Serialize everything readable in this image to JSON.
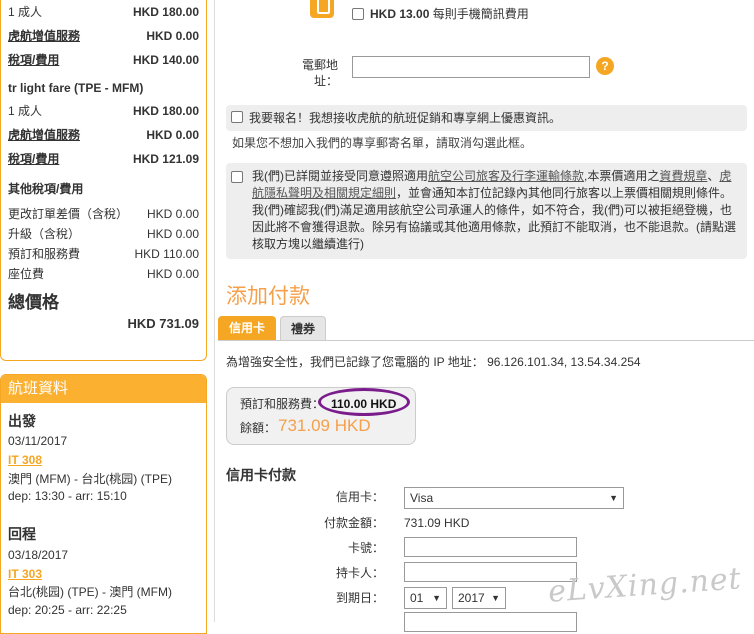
{
  "summary": {
    "r1_label": "1 成人",
    "r1_value": "HKD  180.00",
    "r2_label": "虎航增值服務",
    "r2_value": "HKD  0.00",
    "r3_label": "稅項/費用",
    "r3_value": "HKD  140.00",
    "return_fare": "tr light fare (TPE - MFM)",
    "r4_label": "1 成人",
    "r4_value": "HKD  180.00",
    "r5_label": "虎航增值服務",
    "r5_value": "HKD  0.00",
    "r6_label": "稅項/費用",
    "r6_value": "HKD  121.09",
    "other_taxes": "其他稅項/費用",
    "o1_label": "更改訂單差價（含稅）",
    "o1_value": "HKD  0.00",
    "o2_label": "升級（含稅）",
    "o2_value": "HKD  0.00",
    "o3_label": "預訂和服務費",
    "o3_value": "HKD  110.00",
    "o4_label": "座位費",
    "o4_value": "HKD  0.00",
    "total_label": "總價格",
    "total_value": "HKD  731.09"
  },
  "flight": {
    "header": "航班資料",
    "depart_label": "出發",
    "depart_date": "03/11/2017",
    "depart_no": "IT 308",
    "depart_route": "澳門 (MFM) - 台北(桃园) (TPE)",
    "depart_time": "dep:  13:30 - arr:  15:10",
    "return_label": "回程",
    "return_date": "03/18/2017",
    "return_no": "IT 303",
    "return_route": "台北(桃园) (TPE) - 澳門 (MFM)",
    "return_time": "dep:  20:25 - arr:  22:25"
  },
  "main": {
    "sms_price": "HKD 13.00",
    "sms_text": "每則手機簡訊費用",
    "email_label": "電郵地址：",
    "help": "?",
    "promo_text": "我要報名！我想接收虎航的航班促銷和專享網上優惠資訊。",
    "unsub_text": "如果您不想加入我們的專享郵寄名單，請取消勾選此框。",
    "terms_1": "我(們)已詳閱並接受同意遵照適用",
    "terms_link1": "航空公司旅客及行李運輸條款",
    "terms_2": ",本票價適用之",
    "terms_link2": "資費規章",
    "terms_3": "、",
    "terms_link3": "虎航隱私聲明及相關規定細則",
    "terms_4": "，並會通知本訂位記錄內其他同行旅客以上票價相關規則條件。我(們)確認我(們)滿足適用該航空公司承運人的條件，如不符合，我(們)可以被拒絕登機，也因此將不會獲得退款。除另有協議或其他適用條款，此預訂不能取消，也不能退款。(請點選核取方塊以繼續進行)",
    "pay_title": "添加付款",
    "tab_credit": "信用卡",
    "tab_voucher": "禮券",
    "ip_text": "為增強安全性，我們已記錄了您電腦的 IP 地址：  96.126.101.34, 13.54.34.254",
    "fee_label": "預訂和服務費：",
    "fee_value": "110.00 HKD",
    "balance_label": "餘額：",
    "balance_value": "731.09 HKD",
    "cc_title": "信用卡付款",
    "card_label": "信用卡：",
    "card_value": "Visa",
    "amount_label": "付款金額：",
    "amount_value": "731.09 HKD",
    "cardno_label": "卡號：",
    "holder_label": "持卡人：",
    "expiry_label": "到期日：",
    "month_value": "01",
    "year_value": "2017",
    "watermark": "eLvXing.net"
  }
}
